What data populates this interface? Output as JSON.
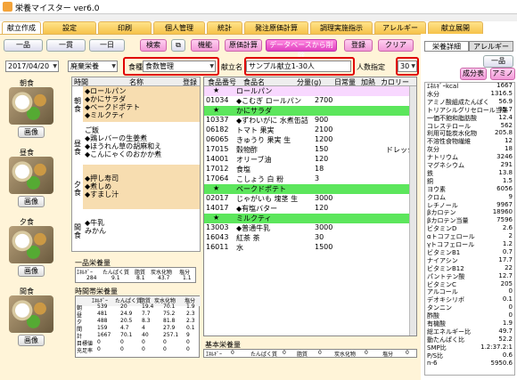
{
  "app": {
    "title": "栄養マイスター ver6.0"
  },
  "tabs": [
    "献立作成",
    "設定",
    "印刷",
    "個人管理",
    "統計",
    "発注原価計算",
    "調理実施指示",
    "アレルギー",
    "献立展開"
  ],
  "toolbar": {
    "ikkatsu": "一品",
    "ikkan": "一貫",
    "ichinichi": "一日",
    "kensaku": "検索",
    "kino": "機能",
    "genka": "原価計算",
    "db_delete": "データベースから削除",
    "toroku": "登録",
    "clear": "クリア"
  },
  "form": {
    "date": "2017/04/20",
    "category": "廃棄栄養",
    "shokushu_label": "食種",
    "shokushu": "食数管理",
    "kondate_label": "献立名",
    "kondate": "サンプル献立1-30人",
    "ninzu_label": "人数指定",
    "ninzu": "30"
  },
  "meals": {
    "asa": "朝食",
    "hiru": "昼食",
    "yuu": "夕食",
    "kan": "間食",
    "gazo": "画像"
  },
  "menu_header": {
    "jikan": "時間",
    "meisho": "名称",
    "toroku": "登録"
  },
  "menu_items": {
    "asa": [
      "◆ロールパン",
      "◆かにサラダ",
      "◆ベークドポテト",
      "◆ミルクティ"
    ],
    "hiru": [
      "ご飯",
      "◆鶏レバーの生姜煮",
      "◆ほうれん草の胡麻和え",
      "◆こんにゃくのおかか煮"
    ],
    "yuu": [
      "◆押し寿司",
      "◆煮しめ",
      "◆すまし汁"
    ],
    "kan": [
      "◆牛乳",
      "みかん"
    ]
  },
  "ippin": {
    "title": "一品栄養量",
    "headers": [
      "ｴﾈﾙｷﾞｰ",
      "たんぱく質",
      "脂質",
      "炭水化物",
      "塩分"
    ],
    "values": [
      "284",
      "9.1",
      "8.1",
      "43.7",
      "1.1"
    ]
  },
  "jikan_betsu": {
    "title": "時間帯栄養量",
    "headers": [
      "",
      "ｴﾈﾙｷﾞｰ",
      "たんぱく質",
      "脂質",
      "炭水化物",
      "塩分"
    ],
    "rows": [
      [
        "朝",
        "539",
        "20",
        "19.4",
        "70.1",
        "1.9"
      ],
      [
        "昼",
        "481",
        "24.9",
        "7.7",
        "75.2",
        "2.3"
      ],
      [
        "夕",
        "488",
        "20.5",
        "8.3",
        "81.8",
        "2.3"
      ],
      [
        "間",
        "159",
        "4.7",
        "4",
        "27.9",
        "0.1"
      ],
      [
        "計",
        "1667",
        "70.1",
        "40",
        "257.1",
        "9"
      ],
      [
        "目標値",
        "0",
        "0",
        "0",
        "0",
        "0"
      ],
      [
        "充足率",
        "0",
        "0",
        "0",
        "0",
        "0"
      ]
    ]
  },
  "detail": {
    "headers": [
      "食品番号",
      "食品名",
      "分量(g)",
      "日常量",
      "加熱",
      "カロリー"
    ],
    "groups": [
      {
        "name": "ロールパン",
        "foods": [
          [
            "01034",
            "◆こむぎ ロールパン",
            "2700"
          ]
        ]
      },
      {
        "name": "かにサラダ",
        "foods": [
          [
            "10337",
            "◆ずわいがに 水煮缶詰",
            "900"
          ],
          [
            "06182",
            "トマト 果実",
            "2100"
          ],
          [
            "06065",
            "きゅうり 果実 生",
            "1200"
          ],
          [
            "17015",
            "穀物酢",
            "150"
          ],
          [
            "14001",
            "オリーブ油",
            "120"
          ],
          [
            "17012",
            "食塩",
            "18"
          ],
          [
            "17064",
            "こしょう 白 粉",
            "3"
          ]
        ]
      },
      {
        "name": "ベークドポテト",
        "foods": [
          [
            "02017",
            "じゃがいも 塊茎 生",
            "3000"
          ],
          [
            "14017",
            "◆有塩バター",
            "120"
          ]
        ]
      },
      {
        "name": "ミルクティ",
        "foods": [
          [
            "13003",
            "◆普通牛乳",
            "3000"
          ],
          [
            "16043",
            "紅茶 茶",
            "30"
          ],
          [
            "16011",
            "水",
            "1500"
          ]
        ]
      }
    ],
    "note": "ドレッシ"
  },
  "kihon": {
    "title": "基本栄養量",
    "headers": [
      "ｴﾈﾙｷﾞｰ",
      "0",
      "たんぱく質",
      "0",
      "脂質",
      "0",
      "炭水化物",
      "0",
      "塩分",
      "0"
    ]
  },
  "right": {
    "tabs": [
      "栄養詳細",
      "アレルギー"
    ],
    "btn1": "一品",
    "btn2": "成分表",
    "btn3": "アミノ",
    "nutrients": [
      [
        "ｴﾈﾙｷﾞｰkcal",
        "1667"
      ],
      [
        "水分",
        "1316.5"
      ],
      [
        "アミノ酸組成たんぱく",
        "56.9"
      ],
      [
        "トリアシルグリセロール当量",
        "35.7"
      ],
      [
        "一価不飽和脂肪酸",
        "12.4"
      ],
      [
        "コレステロール",
        "562"
      ],
      [
        "利用可能炭水化物",
        "205.8"
      ],
      [
        "不溶性食物繊維",
        "12"
      ],
      [
        "灰分",
        "18"
      ],
      [
        "ナトリウム",
        "3246"
      ],
      [
        "マグネシウム",
        "291"
      ],
      [
        "鉄",
        "13.8"
      ],
      [
        "銅",
        "1.5"
      ],
      [
        "ヨウ素",
        "6056"
      ],
      [
        "クロム",
        "9"
      ],
      [
        "レチノール",
        "9967"
      ],
      [
        "βカロテン",
        "18960"
      ],
      [
        "βカロテン当量",
        "7596"
      ],
      [
        "ビタミンD",
        "2.6"
      ],
      [
        "αトコフェロール",
        "2"
      ],
      [
        "γトコフェロール",
        "1.2"
      ],
      [
        "ビタミンB1",
        "0.7"
      ],
      [
        "ナイアシン",
        "17.7"
      ],
      [
        "ビタミンB12",
        "22"
      ],
      [
        "パントテン酸",
        "12.7"
      ],
      [
        "ビタミンC",
        "205"
      ],
      [
        "アルコール",
        "0"
      ],
      [
        "デオキシリボ",
        "0.1"
      ],
      [
        "タンニン",
        "0"
      ],
      [
        "酢酸",
        "0"
      ],
      [
        "有機酸",
        "1.9"
      ],
      [
        "総エネルギー比",
        "49.7"
      ],
      [
        "動たんぱく比",
        "52.2"
      ],
      [
        "SMP比",
        "1.2:37.2:1"
      ],
      [
        "P/S比",
        "0.6"
      ],
      [
        "n-6",
        "5950.6"
      ]
    ]
  }
}
